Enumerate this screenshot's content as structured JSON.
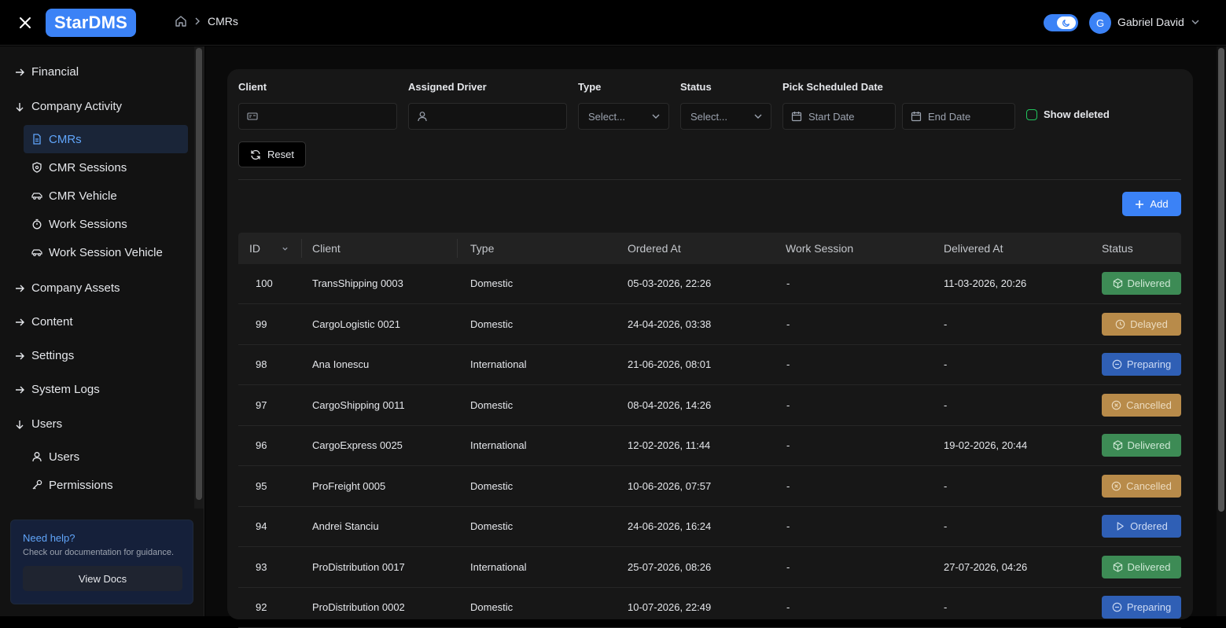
{
  "app": {
    "logo": "StarDMS"
  },
  "breadcrumb": {
    "current": "CMRs"
  },
  "user": {
    "initial": "G",
    "name": "Gabriel David"
  },
  "sidebar": {
    "groups": [
      {
        "label": "Financial",
        "expanded": false
      },
      {
        "label": "Company Activity",
        "expanded": true
      },
      {
        "label": "Company Assets",
        "expanded": false
      },
      {
        "label": "Content",
        "expanded": false
      },
      {
        "label": "Settings",
        "expanded": false
      },
      {
        "label": "System Logs",
        "expanded": false
      },
      {
        "label": "Users",
        "expanded": true
      }
    ],
    "activity_items": [
      {
        "label": "CMRs",
        "icon": "document-icon",
        "active": true
      },
      {
        "label": "CMR Sessions",
        "icon": "shield-icon"
      },
      {
        "label": "CMR Vehicle",
        "icon": "car-icon"
      },
      {
        "label": "Work Sessions",
        "icon": "stopwatch-icon"
      },
      {
        "label": "Work Session Vehicle",
        "icon": "car-icon"
      }
    ],
    "users_items": [
      {
        "label": "Users",
        "icon": "user-icon"
      },
      {
        "label": "Permissions",
        "icon": "key-icon"
      }
    ],
    "help": {
      "title": "Need help?",
      "text": "Check our documentation for guidance.",
      "button": "View Docs"
    }
  },
  "filters": {
    "client_label": "Client",
    "driver_label": "Assigned Driver",
    "type_label": "Type",
    "type_placeholder": "Select...",
    "status_label": "Status",
    "status_placeholder": "Select...",
    "date_label": "Pick Scheduled Date",
    "start_placeholder": "Start Date",
    "end_placeholder": "End Date",
    "show_deleted": "Show deleted",
    "reset": "Reset"
  },
  "add_button": "Add",
  "table": {
    "columns": [
      "ID",
      "Client",
      "Type",
      "Ordered At",
      "Work Session",
      "Delivered At",
      "Status"
    ],
    "rows": [
      {
        "id": "100",
        "client": "TransShipping 0003",
        "type": "Domestic",
        "ordered": "05-03-2026, 22:26",
        "session": "-",
        "delivered": "11-03-2026, 20:26",
        "status": "Delivered"
      },
      {
        "id": "99",
        "client": "CargoLogistic 0021",
        "type": "Domestic",
        "ordered": "24-04-2026, 03:38",
        "session": "-",
        "delivered": "-",
        "status": "Delayed"
      },
      {
        "id": "98",
        "client": "Ana Ionescu",
        "type": "International",
        "ordered": "21-06-2026, 08:01",
        "session": "-",
        "delivered": "-",
        "status": "Preparing"
      },
      {
        "id": "97",
        "client": "CargoShipping 0011",
        "type": "Domestic",
        "ordered": "08-04-2026, 14:26",
        "session": "-",
        "delivered": "-",
        "status": "Cancelled"
      },
      {
        "id": "96",
        "client": "CargoExpress 0025",
        "type": "International",
        "ordered": "12-02-2026, 11:44",
        "session": "-",
        "delivered": "19-02-2026, 20:44",
        "status": "Delivered"
      },
      {
        "id": "95",
        "client": "ProFreight 0005",
        "type": "Domestic",
        "ordered": "10-06-2026, 07:57",
        "session": "-",
        "delivered": "-",
        "status": "Cancelled"
      },
      {
        "id": "94",
        "client": "Andrei Stanciu",
        "type": "Domestic",
        "ordered": "24-06-2026, 16:24",
        "session": "-",
        "delivered": "-",
        "status": "Ordered"
      },
      {
        "id": "93",
        "client": "ProDistribution 0017",
        "type": "International",
        "ordered": "25-07-2026, 08:26",
        "session": "-",
        "delivered": "27-07-2026, 04:26",
        "status": "Delivered"
      },
      {
        "id": "92",
        "client": "ProDistribution 0002",
        "type": "Domestic",
        "ordered": "10-07-2026, 22:49",
        "session": "-",
        "delivered": "-",
        "status": "Preparing"
      }
    ]
  }
}
